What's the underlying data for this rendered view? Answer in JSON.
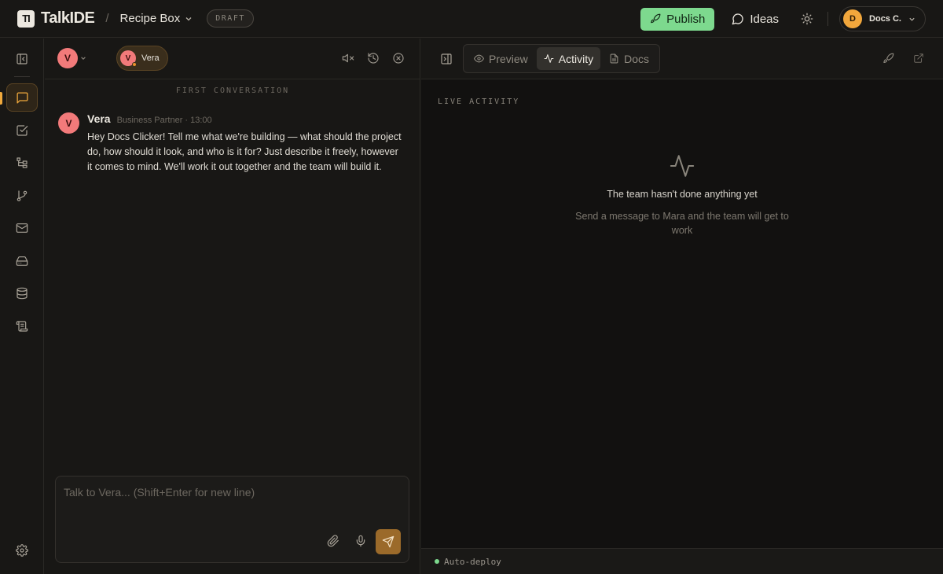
{
  "app": {
    "logo_mark": "TI",
    "name": "TalkIDE",
    "separator": "/",
    "project": "Recipe Box",
    "status_badge": "DRAFT"
  },
  "header": {
    "publish_label": "Publish",
    "ideas_label": "Ideas",
    "user_initial": "D",
    "user_name": "Docs C."
  },
  "rail": {
    "items": [
      {
        "icon": "panel-collapse-icon"
      },
      {
        "icon": "chat-icon",
        "active": true
      },
      {
        "icon": "tasks-icon"
      },
      {
        "icon": "structure-icon"
      },
      {
        "icon": "git-branch-icon"
      },
      {
        "icon": "mail-icon"
      },
      {
        "icon": "drive-icon"
      },
      {
        "icon": "database-icon"
      },
      {
        "icon": "script-icon"
      },
      {
        "icon": "settings-icon"
      }
    ]
  },
  "chat": {
    "agent_initial": "V",
    "agent_pill_name": "Vera",
    "conversation_label": "FIRST CONVERSATION",
    "messages": [
      {
        "author_initial": "V",
        "author": "Vera",
        "meta": "Business Partner · 13:00",
        "text": "Hey Docs Clicker! Tell me what we're building — what should the project do, how should it look, and who is it for? Just describe it freely, however it comes to mind. We'll work it out together and the team will build it."
      }
    ],
    "composer": {
      "placeholder": "Talk to Vera... (Shift+Enter for new line)",
      "value": ""
    }
  },
  "panel": {
    "tabs": [
      {
        "label": "Preview",
        "icon": "eye-icon"
      },
      {
        "label": "Activity",
        "icon": "activity-icon",
        "active": true
      },
      {
        "label": "Docs",
        "icon": "doc-icon"
      }
    ],
    "section_label": "LIVE ACTIVITY",
    "empty_title": "The team hasn't done anything yet",
    "empty_subtitle": "Send a message to Mara and the team will get to work",
    "footer_status": "Auto-deploy"
  },
  "colors": {
    "accent": "#f0a93c",
    "publish": "#7dd98e",
    "avatar": "#f27a7a",
    "user_avatar": "#f2a73c"
  }
}
